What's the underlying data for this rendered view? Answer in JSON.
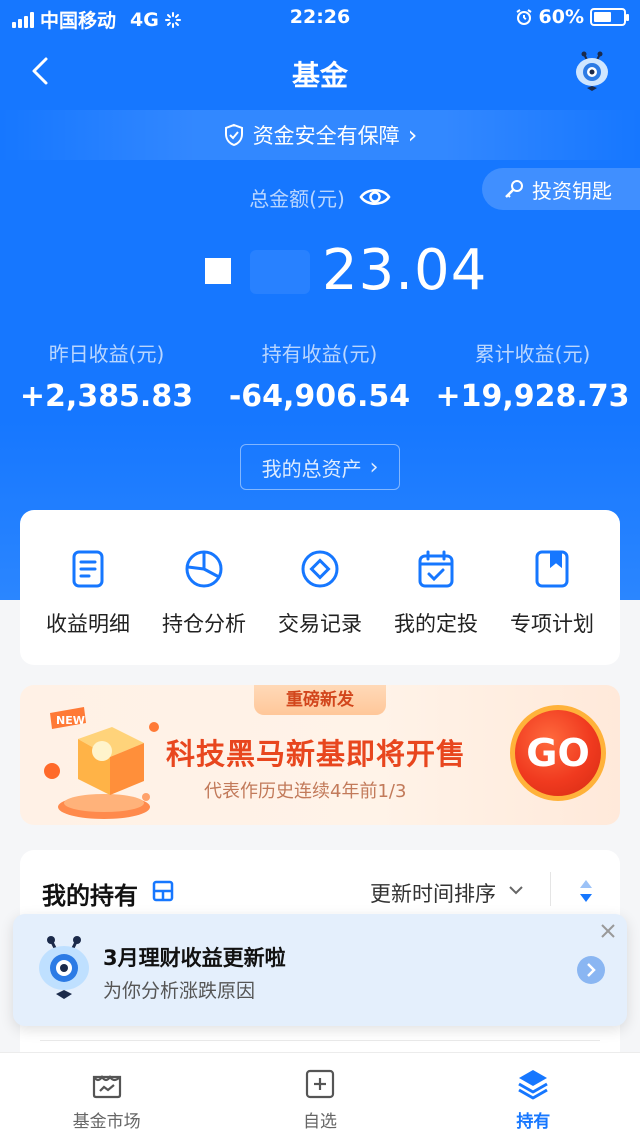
{
  "status_bar": {
    "carrier": "中国移动",
    "network": "4G",
    "time": "22:26",
    "battery": "60%",
    "battery_level": 0.6
  },
  "nav": {
    "title": "基金",
    "back_icon": "chevron-left-icon",
    "mascot_icon": "mascot-icon"
  },
  "security": {
    "label": "资金安全有保障",
    "arrow": "›"
  },
  "summary": {
    "total_label": "总金额(元)",
    "total_amount": "23.04",
    "invest_key_label": "投资钥匙",
    "stats": [
      {
        "label": "昨日收益(元)",
        "value": "+2,385.83"
      },
      {
        "label": "持有收益(元)",
        "value": "-64,906.54"
      },
      {
        "label": "累计收益(元)",
        "value": "+19,928.73"
      }
    ],
    "total_assets_label": "我的总资产",
    "total_assets_arrow": "›"
  },
  "quick_actions": [
    {
      "label": "收益明细",
      "icon": "document-icon"
    },
    {
      "label": "持仓分析",
      "icon": "pie-chart-icon"
    },
    {
      "label": "交易记录",
      "icon": "diamond-circle-icon"
    },
    {
      "label": "我的定投",
      "icon": "calendar-check-icon"
    },
    {
      "label": "专项计划",
      "icon": "bookmark-icon"
    }
  ],
  "promo": {
    "tag": "重磅新发",
    "title": "科技黑马新基即将开售",
    "subtitle": "代表作历史连续4年前1/3",
    "go_label": "GO",
    "badge": "NEW"
  },
  "holdings": {
    "title": "我的持有",
    "sort_label": "更新时间排序"
  },
  "notice": {
    "title": "3月理财收益更新啦",
    "subtitle": "为你分析涨跌原因"
  },
  "tabs": [
    {
      "label": "基金市场",
      "icon": "market-icon",
      "active": false
    },
    {
      "label": "自选",
      "icon": "add-favorite-icon",
      "active": false
    },
    {
      "label": "持有",
      "icon": "layers-icon",
      "active": true
    }
  ],
  "colors": {
    "primary": "#1677ff",
    "promo_red": "#e8461e",
    "go_ring": "#ffb23a"
  }
}
